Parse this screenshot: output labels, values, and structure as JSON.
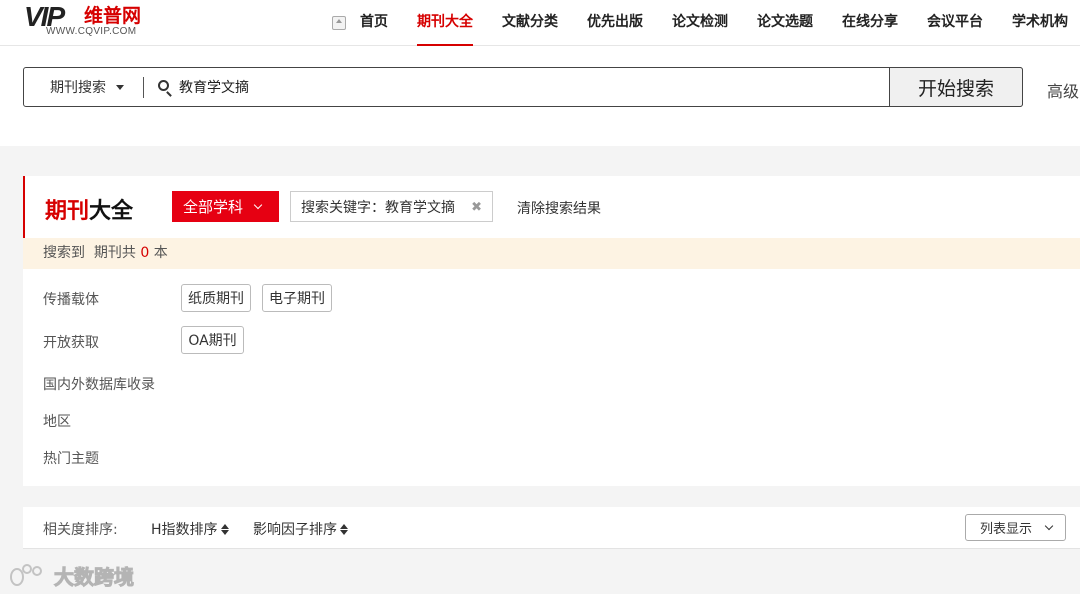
{
  "header": {
    "logo": {
      "brand": "VIP",
      "name_cn": "维普网",
      "url": "WWW.CQVIP.COM"
    },
    "nav": [
      {
        "label": "首页",
        "active": false
      },
      {
        "label": "期刊大全",
        "active": true
      },
      {
        "label": "文献分类",
        "active": false
      },
      {
        "label": "优先出版",
        "active": false
      },
      {
        "label": "论文检测",
        "active": false
      },
      {
        "label": "论文选题",
        "active": false
      },
      {
        "label": "在线分享",
        "active": false
      },
      {
        "label": "会议平台",
        "active": false
      },
      {
        "label": "学术机构",
        "active": false
      }
    ]
  },
  "search": {
    "scope": "期刊搜索",
    "query": "教育学文摘",
    "button": "开始搜索",
    "advanced": "高级"
  },
  "page": {
    "title_red": "期刊",
    "title_black": "大全",
    "subject_button": "全部学科",
    "keyword_tag": "搜索关键字：教育学文摘",
    "clear_label": "清除搜索结果"
  },
  "result": {
    "prefix": "搜索到",
    "middle": "期刊共",
    "count": "0",
    "suffix": "本"
  },
  "filters": [
    {
      "label": "传播载体",
      "chips": [
        "纸质期刊",
        "电子期刊"
      ]
    },
    {
      "label": "开放获取",
      "chips": [
        "OA期刊"
      ]
    },
    {
      "label": "国内外数据库收录",
      "chips": []
    },
    {
      "label": "地区",
      "chips": []
    },
    {
      "label": "热门主题",
      "chips": []
    }
  ],
  "sort": {
    "label": "相关度排序:",
    "options": [
      "H指数排序",
      "影响因子排序"
    ],
    "view": "列表显示"
  },
  "watermark": "大数跨境",
  "colors": {
    "accent": "#d60000",
    "button_red": "#e60012",
    "result_bg": "#fdf3e3"
  }
}
